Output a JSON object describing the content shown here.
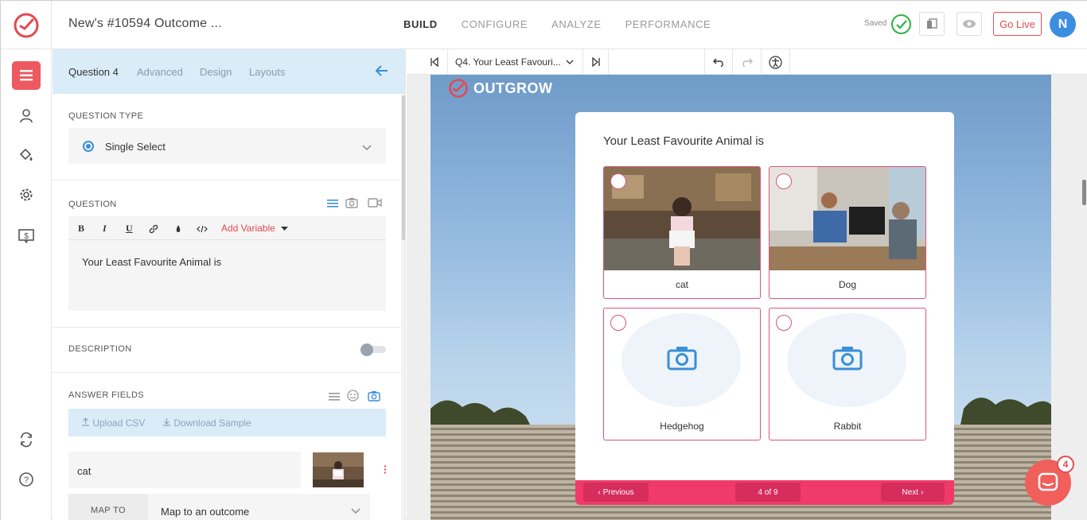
{
  "header": {
    "doc_title": "New's #10594 Outcome ...",
    "tabs": [
      {
        "label": "BUILD",
        "active": true
      },
      {
        "label": "CONFIGURE"
      },
      {
        "label": "ANALYZE"
      },
      {
        "label": "PERFORMANCE"
      }
    ],
    "saved_label": "Saved",
    "go_live_label": "Go Live",
    "avatar_initial": "N"
  },
  "panel": {
    "tabs": [
      "Question 4",
      "Advanced",
      "Design",
      "Layouts"
    ],
    "question_type_label": "QUESTION TYPE",
    "question_type_value": "Single Select",
    "question_label": "QUESTION",
    "editor_tools": [
      "B",
      "I",
      "U"
    ],
    "add_variable_label": "Add Variable",
    "question_text": "Your Least Favourite Animal is",
    "description_label": "DESCRIPTION",
    "description_enabled": false,
    "answer_fields_label": "ANSWER FIELDS",
    "upload_csv_label": "Upload CSV",
    "download_sample_label": "Download Sample",
    "first_answer": "cat",
    "map_to_label": "MAP TO",
    "map_to_value": "Map to an outcome"
  },
  "preview": {
    "question_selector": "Q4. Your Least Favouri...",
    "brand": "OUTGROW",
    "question": "Your Least Favourite Animal is",
    "options": [
      {
        "label": "cat",
        "has_image": true
      },
      {
        "label": "Dog",
        "has_image": true
      },
      {
        "label": "Hedgehog",
        "has_image": false
      },
      {
        "label": "Rabbit",
        "has_image": false
      }
    ],
    "prev_label": "Previous",
    "page_indicator": "4 of 9",
    "next_label": "Next"
  },
  "chat": {
    "badge_count": "4"
  },
  "colors": {
    "accent": "#e24b52",
    "blue": "#3a8fd8",
    "footer_pink": "#f03b6a"
  }
}
